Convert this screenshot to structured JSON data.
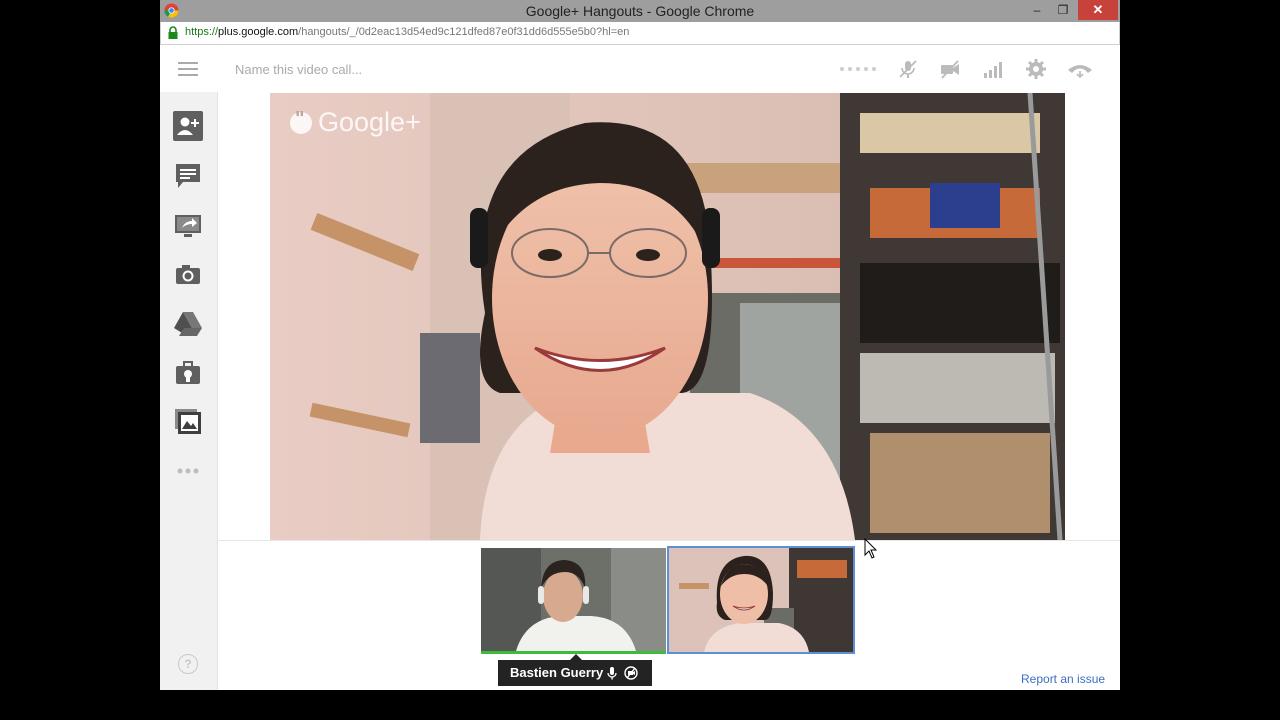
{
  "window": {
    "title": "Google+ Hangouts - Google Chrome",
    "minimize": "‒",
    "restore": "❐",
    "close": "✕"
  },
  "address_bar": {
    "scheme": "https://",
    "host": "plus.google.com",
    "path": "/hangouts/_/0d2eac13d54ed9c121dfed87e0f31dd6d555e5b0?hl=en"
  },
  "toolbar": {
    "menu_icon": "hamburger-menu-icon",
    "call_name_placeholder": "Name this video call...",
    "icons": [
      "more-dots-icon",
      "mute-mic-icon",
      "turn-off-camera-icon",
      "bandwidth-icon",
      "settings-gear-icon",
      "hang-up-icon"
    ]
  },
  "sidebar": {
    "items": [
      {
        "icon": "invite-people-icon"
      },
      {
        "icon": "chat-icon"
      },
      {
        "icon": "screenshare-icon"
      },
      {
        "icon": "capture-camera-icon"
      },
      {
        "icon": "google-drive-icon"
      },
      {
        "icon": "remote-desktop-icon"
      },
      {
        "icon": "effects-icon"
      },
      {
        "icon": "more-apps-icon"
      }
    ],
    "help_label": "?"
  },
  "main_video": {
    "watermark": "Google+"
  },
  "participants": [
    {
      "name": "Bastien Guerry",
      "speaking": true
    },
    {
      "name": "",
      "selected": true
    }
  ],
  "name_tag": {
    "name": "Bastien Guerry",
    "icons": [
      "microphone-icon",
      "camera-off-icon"
    ]
  },
  "footer": {
    "report_link": "Report an issue"
  },
  "colors": {
    "accent_blue": "#5b8fd8",
    "speaking_green": "#3dbb3d",
    "close_red": "#c7423a"
  }
}
